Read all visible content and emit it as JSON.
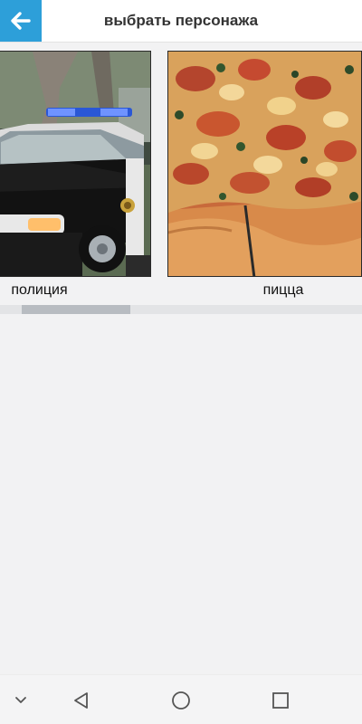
{
  "header": {
    "title": "выбрать персонажа",
    "back_icon": "arrow-left-icon",
    "accent_color": "#2d9fd9"
  },
  "characters": [
    {
      "label": "полиция",
      "image": "police-car"
    },
    {
      "label": "пицца",
      "image": "pizza"
    }
  ],
  "scrollbar": {
    "visible_fraction": 0.3,
    "scroll_position": 0.06
  },
  "navigation_bar": {
    "icons": [
      "chevron-down-icon",
      "back-triangle-icon",
      "home-circle-icon",
      "recents-square-icon"
    ]
  }
}
